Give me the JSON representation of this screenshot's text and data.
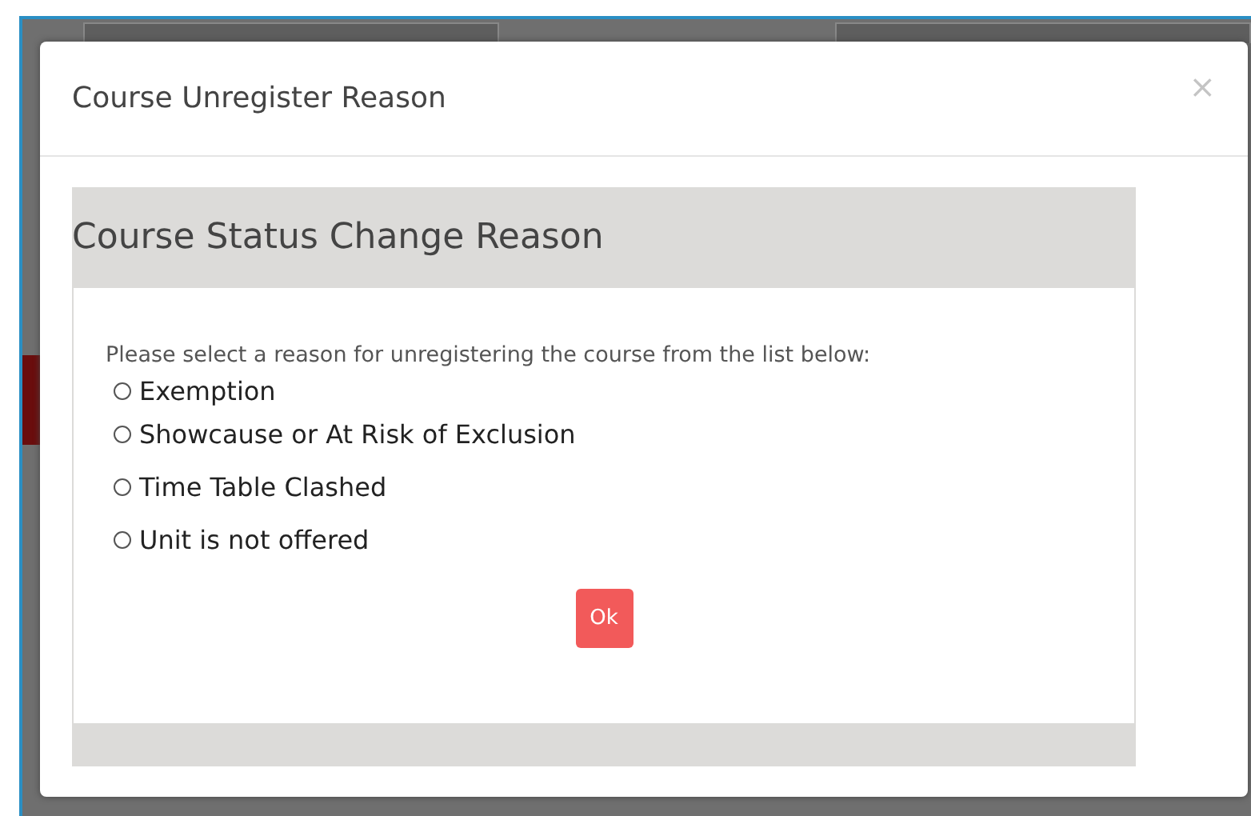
{
  "modal": {
    "title": "Course Unregister Reason",
    "close": "×"
  },
  "panel": {
    "title": "Course Status Change Reason",
    "prompt": "Please select a reason for unregistering the course from the list below:",
    "options": [
      {
        "label": "Exemption",
        "selected": false
      },
      {
        "label": "Showcause or At Risk of Exclusion",
        "selected": false
      },
      {
        "label": "Time Table Clashed",
        "selected": false
      },
      {
        "label": "Unit is not offered",
        "selected": false
      }
    ],
    "button": "Ok"
  }
}
